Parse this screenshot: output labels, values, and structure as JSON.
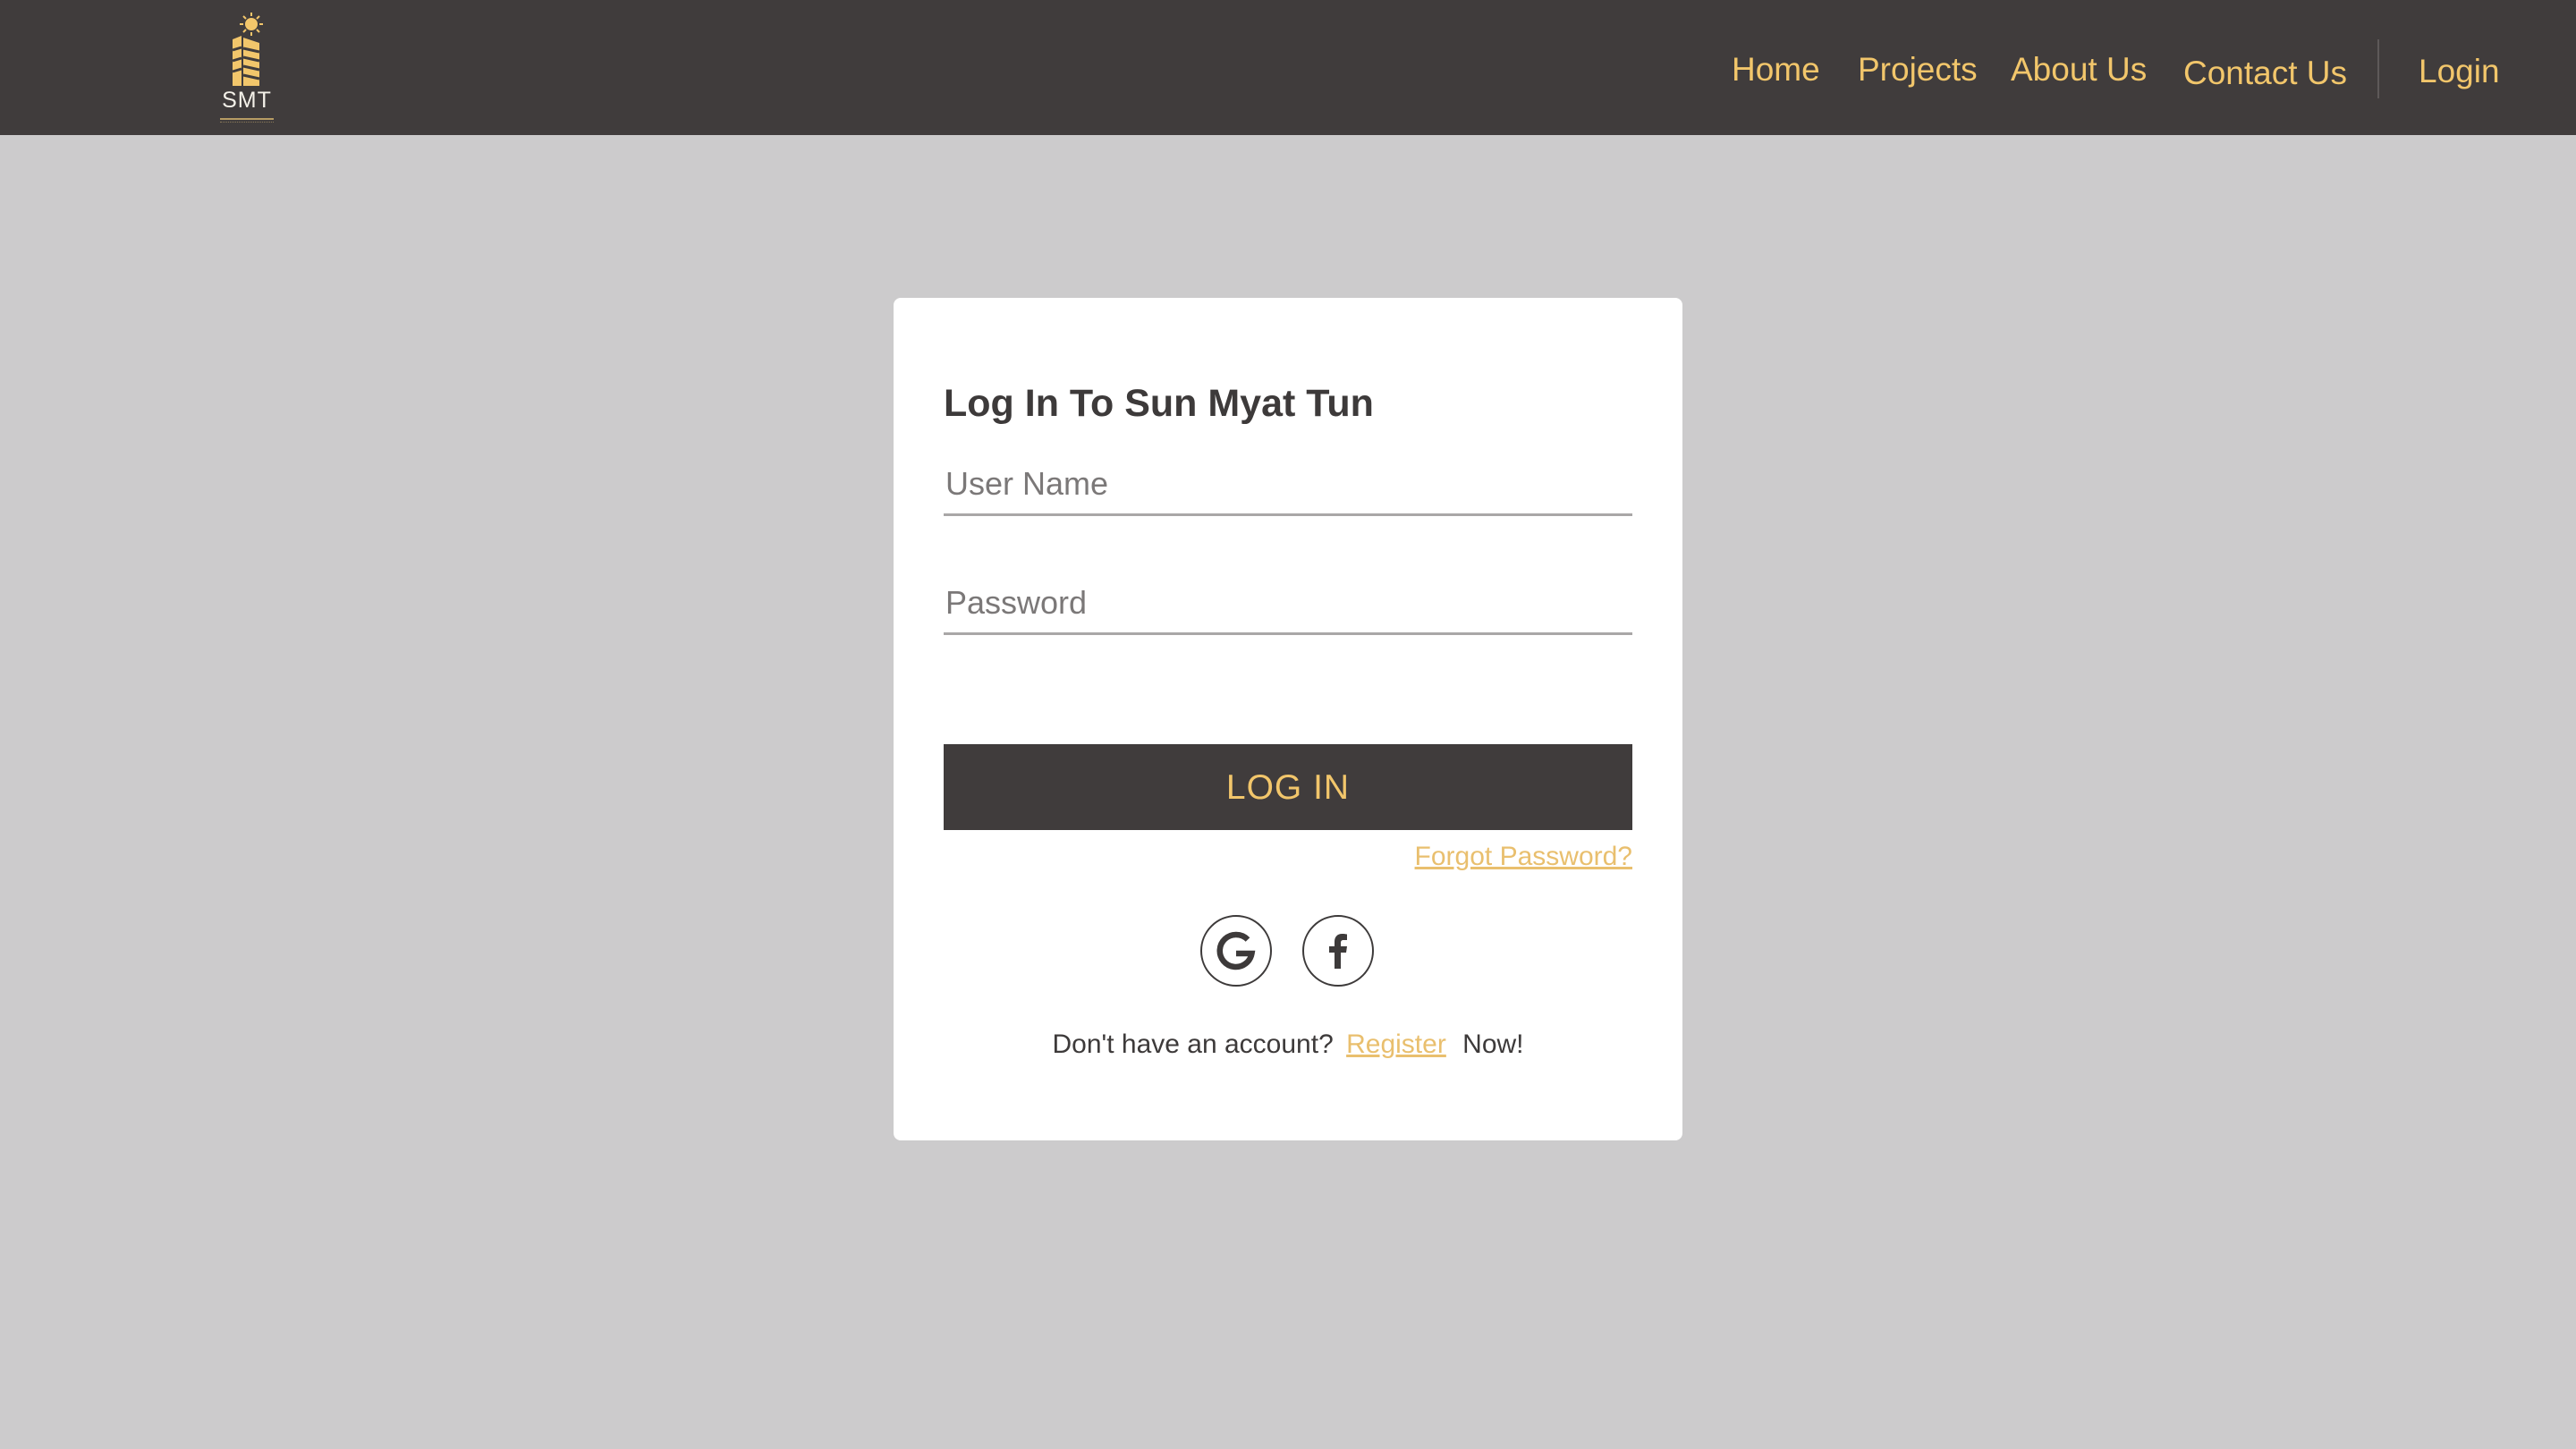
{
  "brand": {
    "logo_text": "SMT",
    "accent_color": "#f2c66b",
    "header_bg": "#403c3c",
    "page_bg": "#cccbcc"
  },
  "nav": {
    "home": "Home",
    "projects": "Projects",
    "about": "About Us",
    "contact": "Contact Us",
    "login": "Login"
  },
  "login_form": {
    "title": "Log In To Sun Myat Tun",
    "username_placeholder": "User Name",
    "password_placeholder": "Password",
    "submit_label": "LOG IN",
    "forgot_password": "Forgot Password?",
    "social_icons": [
      "google-icon",
      "facebook-icon"
    ],
    "register_prefix": "Don't have an account?",
    "register_link": "Register",
    "register_suffix": "Now!"
  }
}
